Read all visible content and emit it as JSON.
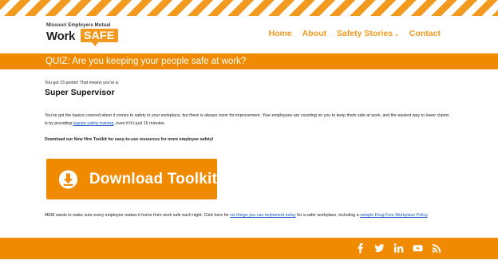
{
  "brand": {
    "tagline": "Missouri Employers Mutual",
    "word1": "Work",
    "word2": "SAFE"
  },
  "nav": {
    "home": "Home",
    "about": "About",
    "safety_stories": "Safety Stories",
    "safety_stories_chevron": "⌄",
    "contact": "Contact"
  },
  "quiz": {
    "title": "QUIZ: Are you keeping your people safe at work?"
  },
  "result": {
    "points_text": "You got 15 points! That means you're a:",
    "rank": "Super Supervisor",
    "para_before_link": "You've got the basics covered when it comes to safety in your workplace, but there is always room for improvement. Your employees are counting on you to keep them safe at work, and the easiest way to lower claims is by providing ",
    "para_link": "regular safety training",
    "para_after_link": ", even if it's just 15 minutes.",
    "toolkit_promo": "Download our New Hire Toolkit for easy-to-use resources for more employee safety!"
  },
  "download": {
    "label": "Download Toolkit",
    "icon": "download-icon"
  },
  "closing": {
    "text_before": "MEM wants to make sure every employee makes it home from work safe each night. Click here for ",
    "link1": "six things you can implement today",
    "text_middle": " for a safer workplace, including a ",
    "link2": "sample Drug-Free Workplace Policy",
    "text_after": "."
  },
  "social": [
    "facebook-icon",
    "twitter-icon",
    "linkedin-icon",
    "youtube-icon",
    "rss-icon"
  ],
  "colors": {
    "accent": "#f08a00",
    "link": "#1a56c4"
  }
}
